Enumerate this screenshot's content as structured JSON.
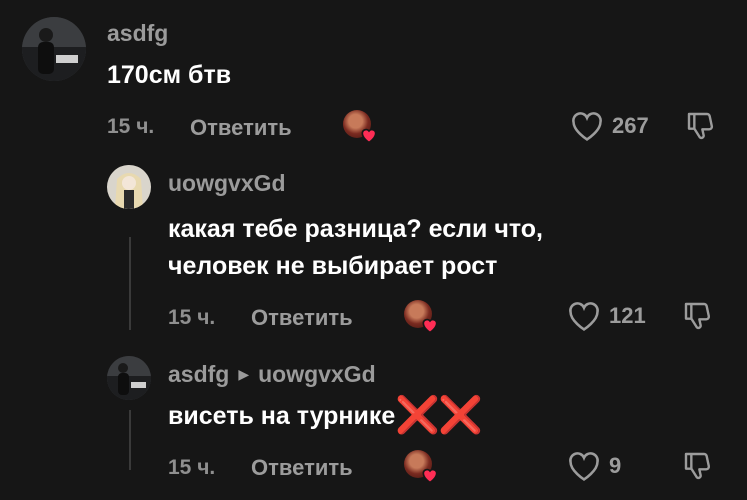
{
  "comments": [
    {
      "username": "asdfg",
      "text": "170см бтв",
      "time": "15 ч.",
      "reply_label": "Ответить",
      "likes": "267"
    },
    {
      "username": "uowgvxGd",
      "text_line1": "какая тебе разница? если что,",
      "text_line2": "человек не выбирает рост",
      "time": "15 ч.",
      "reply_label": "Ответить",
      "likes": "121"
    },
    {
      "username": "asdfg",
      "reply_to": "uowgvxGd",
      "text": "висеть на турнике",
      "emoji": "❌❌",
      "time": "15 ч.",
      "reply_label": "Ответить",
      "likes": "9"
    }
  ],
  "icons": {
    "like": "heart-outline-icon",
    "dislike": "thumbs-down-icon",
    "creator_like": "creator-liked-heart-icon",
    "reply_arrow": "triangle-right-icon"
  },
  "colors": {
    "background": "#161616",
    "text": "#ffffff",
    "muted": "#9c9c9c",
    "creator_heart": "#ff2d55",
    "emoji_x": "#e3262e"
  }
}
